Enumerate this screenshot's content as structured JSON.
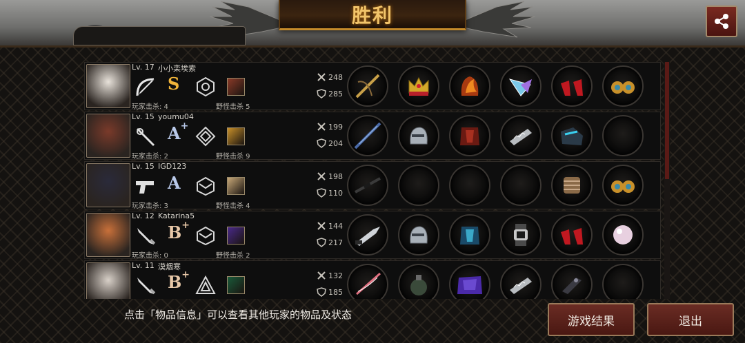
{
  "header": {
    "title": "胜利"
  },
  "hint": "点击「物品信息」可以查看其他玩家的物品及状态",
  "buttons": {
    "result_label": "游戏结果",
    "exit_label": "退出"
  },
  "players": [
    {
      "level": "Lv. 17",
      "name": "小小栾埃索",
      "grade": "S",
      "grade_plus": "",
      "pk": "玩家击杀: 4",
      "mk": "野怪击杀 5",
      "atk": "248",
      "def": "285",
      "weapon": "bow-icon",
      "grade_color": "#f0b43a",
      "items": [
        "crossbow-icon",
        "crown-icon",
        "flame-helmet-icon",
        "crystal-blade-icon",
        "red-heels-icon",
        "gold-earrings-icon"
      ]
    },
    {
      "level": "Lv. 15",
      "name": "youmu04",
      "grade": "A",
      "grade_plus": "+",
      "pk": "玩家击杀: 2",
      "mk": "野怪击杀 9",
      "atk": "199",
      "def": "204",
      "weapon": "rapier-icon",
      "grade_color": "#b8c8e8",
      "items": [
        "spear-icon",
        "steel-helmet-icon",
        "red-armor-icon",
        "spiked-gauntlet-icon",
        "tech-boots-icon",
        "empty"
      ]
    },
    {
      "level": "Lv. 15",
      "name": "IGD123",
      "grade": "A",
      "grade_plus": "",
      "pk": "玩家击杀: 3",
      "mk": "野怪击杀 4",
      "atk": "198",
      "def": "110",
      "weapon": "pistol-icon",
      "grade_color": "#b8c8e8",
      "items": [
        "rifle-icon",
        "empty",
        "empty",
        "empty",
        "bandage-arm-icon",
        "gold-earrings-icon"
      ]
    },
    {
      "level": "Lv. 12",
      "name": "Katarina5",
      "grade": "B",
      "grade_plus": "+",
      "pk": "玩家击杀: 0",
      "mk": "野怪击杀 2",
      "atk": "144",
      "def": "217",
      "weapon": "knife-icon",
      "grade_color": "#e8c8a8",
      "items": [
        "combat-knife-icon",
        "steel-helmet-icon",
        "blue-armor-icon",
        "wrist-watch-icon",
        "red-heels-icon",
        "pearl-icon"
      ]
    },
    {
      "level": "Lv. 11",
      "name": "漠烟寒",
      "grade": "B",
      "grade_plus": "+",
      "pk": "",
      "mk": "",
      "atk": "132",
      "def": "185",
      "weapon": "knife-icon",
      "grade_color": "#e8c8a8",
      "items": [
        "pink-sword-icon",
        "grenade-icon",
        "purple-cloak-icon",
        "spiked-gauntlet-icon",
        "dark-gauntlet-icon",
        "empty"
      ]
    }
  ],
  "colors": {
    "accent_gold": "#f2c46a",
    "button_red": "#5a2018",
    "avatar_bg": [
      "#e8e2da",
      "#7a3a2a",
      "#2a2a3a",
      "#c8703a",
      "#d8d0c8"
    ]
  }
}
